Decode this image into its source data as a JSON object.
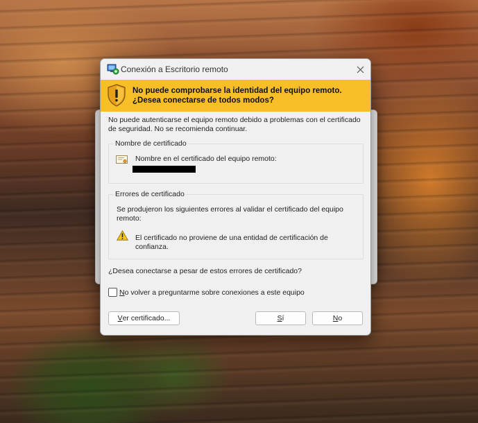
{
  "window": {
    "title": "Conexión a Escritorio remoto",
    "icon": "remote-desktop-icon",
    "close_icon": "close-icon"
  },
  "banner": {
    "icon": "warning-shield-icon",
    "line1": "No puede comprobarse la identidad del equipo remoto.",
    "line2": "¿Desea conectarse de todos modos?",
    "color": "#f8be28"
  },
  "intro": "No puede autenticarse el equipo remoto debido a problemas con el certificado de seguridad. No se recomienda continuar.",
  "certificate_group": {
    "legend": "Nombre de certificado",
    "icon": "certificate-icon",
    "label": "Nombre en el certificado del equipo remoto:",
    "value_redacted": true
  },
  "errors_group": {
    "legend": "Errores de certificado",
    "intro": "Se produjeron los siguientes errores al validar el certificado del equipo remoto:",
    "items": [
      {
        "icon": "warning-triangle-icon",
        "text": "El certificado no proviene de una entidad de certificación de confianza."
      }
    ]
  },
  "question": "¿Desea conectarse a pesar de estos errores de certificado?",
  "checkbox": {
    "label_mnemonic": "N",
    "label_rest": "o volver a preguntarme sobre conexiones a este equipo",
    "checked": false
  },
  "buttons": {
    "view_mnemonic": "V",
    "view_rest": "er certificado...",
    "yes_mnemonic": "S",
    "yes_rest": "í",
    "no_mnemonic": "N",
    "no_rest": "o"
  }
}
